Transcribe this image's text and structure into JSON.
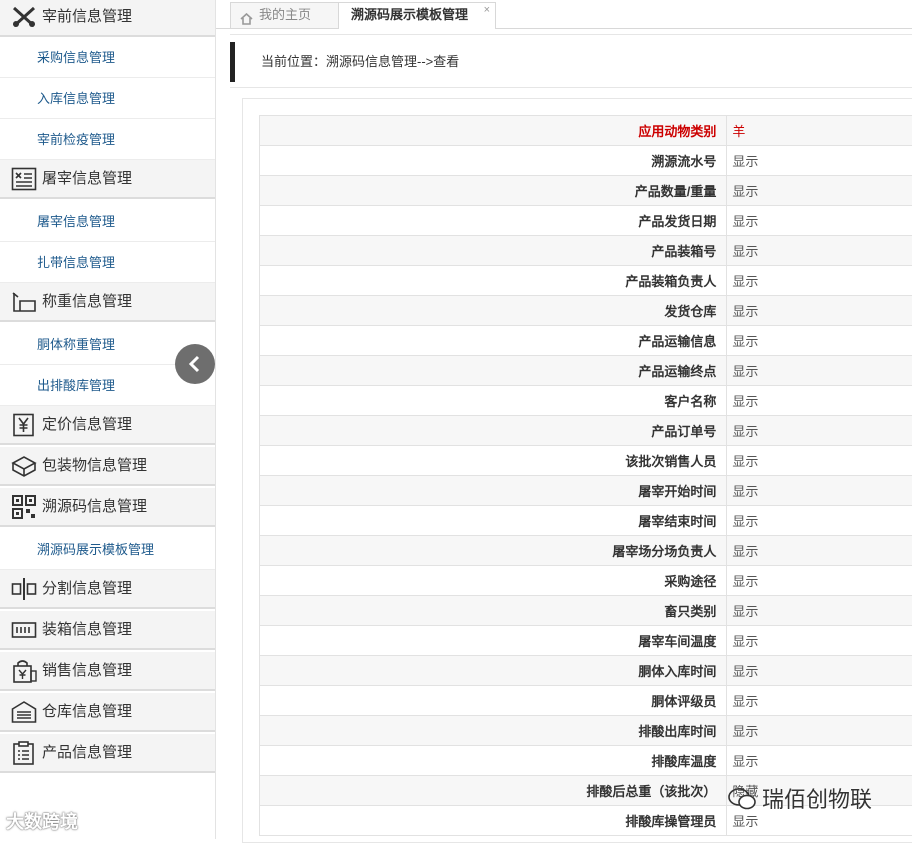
{
  "sidebar": {
    "categories": [
      {
        "label": "宰前信息管理",
        "icon": "scissors-icon"
      },
      {
        "label": "屠宰信息管理",
        "icon": "slaughter-list-icon"
      },
      {
        "label": "称重信息管理",
        "icon": "scale-icon"
      },
      {
        "label": "定价信息管理",
        "icon": "yen-price-icon"
      },
      {
        "label": "包装物信息管理",
        "icon": "package-icon"
      },
      {
        "label": "溯源码信息管理",
        "icon": "qr-code-icon"
      },
      {
        "label": "分割信息管理",
        "icon": "split-icon"
      },
      {
        "label": "装箱信息管理",
        "icon": "box-icon"
      },
      {
        "label": "销售信息管理",
        "icon": "sales-bag-icon"
      },
      {
        "label": "仓库信息管理",
        "icon": "warehouse-icon"
      },
      {
        "label": "产品信息管理",
        "icon": "clipboard-icon"
      }
    ],
    "subitems": {
      "pre_slaughter": [
        "采购信息管理",
        "入库信息管理",
        "宰前检疫管理"
      ],
      "slaughter": [
        "屠宰信息管理",
        "扎带信息管理"
      ],
      "weighing": [
        "胴体称重管理",
        "出排酸库管理"
      ],
      "trace": [
        "溯源码展示模板管理"
      ]
    }
  },
  "tabs": {
    "home": "我的主页",
    "template": "溯源码展示模板管理",
    "close": "×"
  },
  "breadcrumb": "当前位置：溯源码信息管理-->查看",
  "table": {
    "rows": [
      {
        "key": "应用动物类别",
        "value": "羊"
      },
      {
        "key": "溯源流水号",
        "value": "显示"
      },
      {
        "key": "产品数量/重量",
        "value": "显示"
      },
      {
        "key": "产品发货日期",
        "value": "显示"
      },
      {
        "key": "产品装箱号",
        "value": "显示"
      },
      {
        "key": "产品装箱负责人",
        "value": "显示"
      },
      {
        "key": "发货仓库",
        "value": "显示"
      },
      {
        "key": "产品运输信息",
        "value": "显示"
      },
      {
        "key": "产品运输终点",
        "value": "显示"
      },
      {
        "key": "客户名称",
        "value": "显示"
      },
      {
        "key": "产品订单号",
        "value": "显示"
      },
      {
        "key": "该批次销售人员",
        "value": "显示"
      },
      {
        "key": "屠宰开始时间",
        "value": "显示"
      },
      {
        "key": "屠宰结束时间",
        "value": "显示"
      },
      {
        "key": "屠宰场分场负责人",
        "value": "显示"
      },
      {
        "key": "采购途径",
        "value": "显示"
      },
      {
        "key": "畜只类别",
        "value": "显示"
      },
      {
        "key": "屠宰车间温度",
        "value": "显示"
      },
      {
        "key": "胴体入库时间",
        "value": "显示"
      },
      {
        "key": "胴体评级员",
        "value": "显示"
      },
      {
        "key": "排酸出库时间",
        "value": "显示"
      },
      {
        "key": "排酸库温度",
        "value": "显示"
      },
      {
        "key": "排酸后总重（该批次）",
        "value": "隐藏"
      },
      {
        "key": "排酸库操管理员",
        "value": "显示"
      }
    ]
  },
  "watermarks": {
    "left": "大数跨境",
    "right": "瑞佰创物联"
  },
  "colors": {
    "accent_red": "#cc0000",
    "link_blue": "#1e5a8c",
    "sidebar_bg": "#f4f4f4"
  }
}
